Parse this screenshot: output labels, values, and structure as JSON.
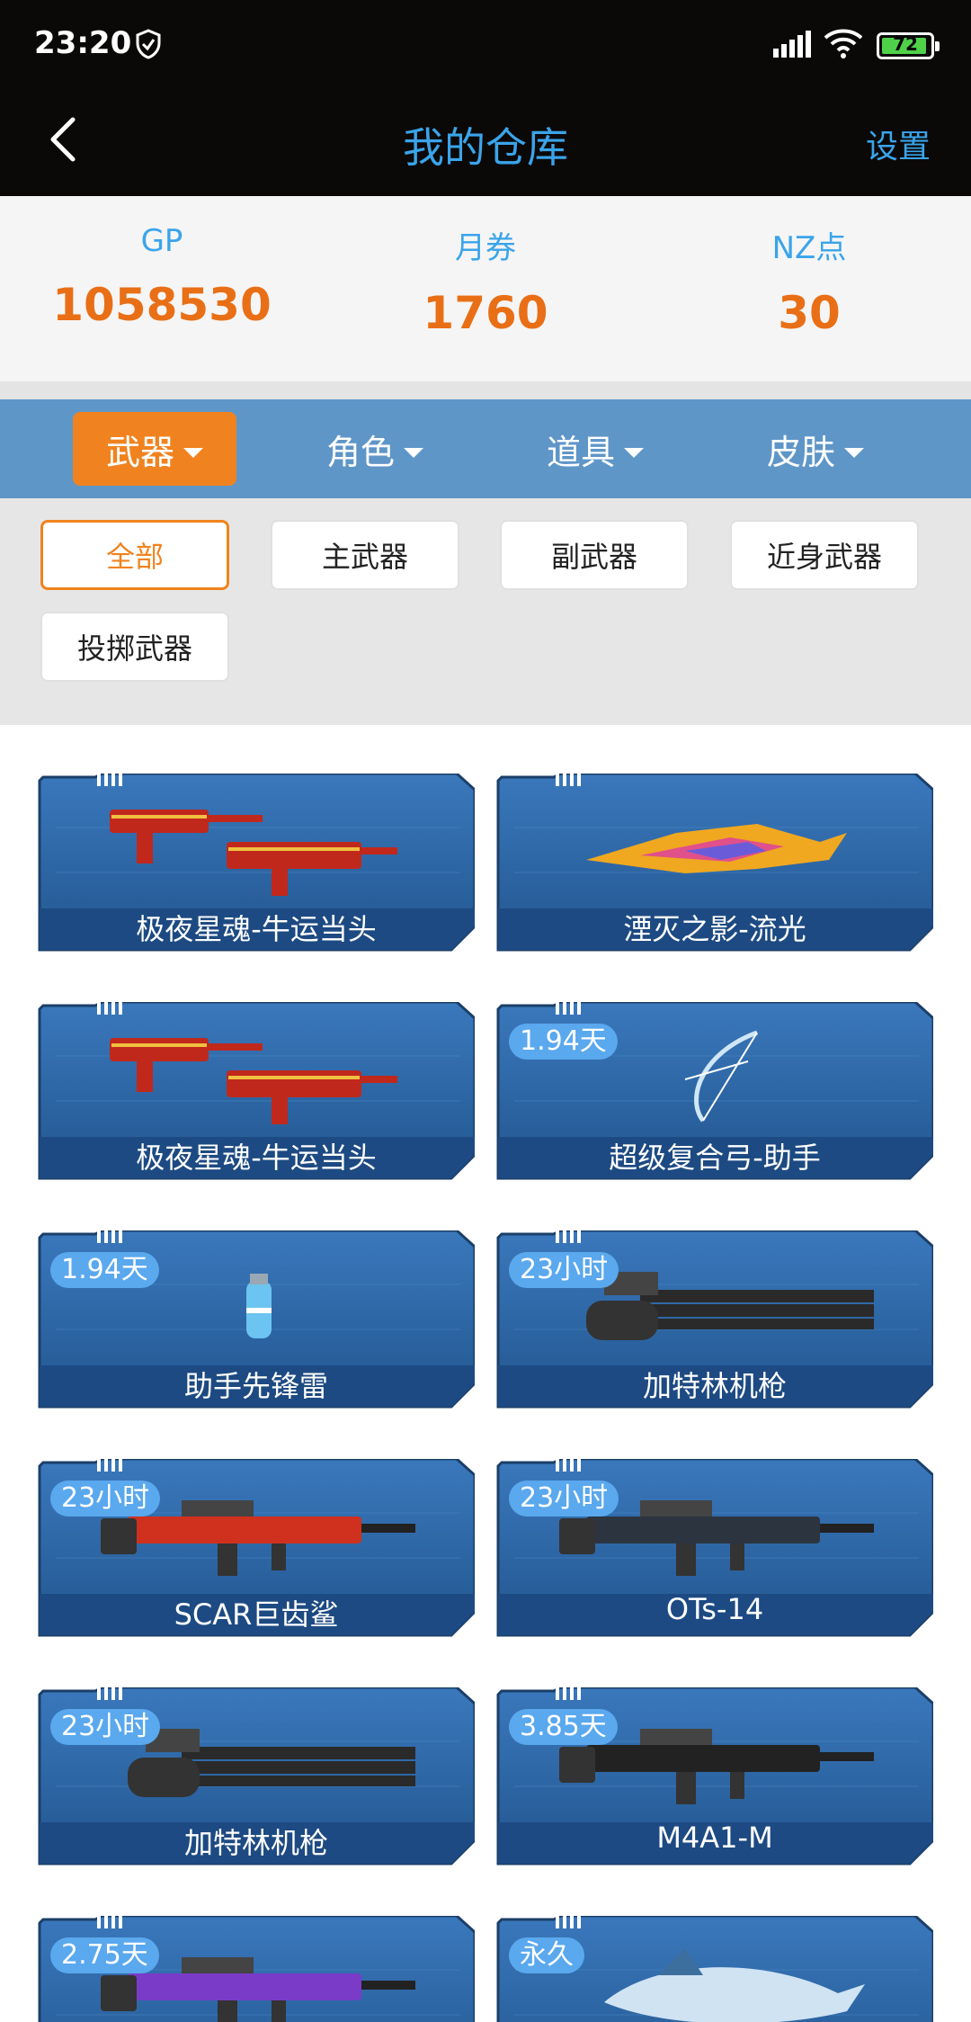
{
  "status": {
    "time": "23:20",
    "battery": "72"
  },
  "nav": {
    "title": "我的仓库",
    "settings": "设置"
  },
  "currency": [
    {
      "label": "GP",
      "value": "1058530"
    },
    {
      "label": "月券",
      "value": "1760"
    },
    {
      "label": "NZ点",
      "value": "30"
    }
  ],
  "categories": [
    "武器",
    "角色",
    "道具",
    "皮肤"
  ],
  "subcategories": [
    "全部",
    "主武器",
    "副武器",
    "近身武器",
    "投掷武器"
  ],
  "items": [
    {
      "name": "极夜星魂-牛运当头",
      "badge": "",
      "icon": "smg-icon",
      "accent": "#c0281c"
    },
    {
      "name": "湮灭之影-流光",
      "badge": "",
      "icon": "blade-icon",
      "accent": "#f0a820"
    },
    {
      "name": "极夜星魂-牛运当头",
      "badge": "",
      "icon": "smg-icon",
      "accent": "#c0281c"
    },
    {
      "name": "超级复合弓-助手",
      "badge": "1.94天",
      "icon": "bow-icon",
      "accent": "#cfe6f5"
    },
    {
      "name": "助手先锋雷",
      "badge": "1.94天",
      "icon": "grenade-icon",
      "accent": "#6cc4f0"
    },
    {
      "name": "加特林机枪",
      "badge": "23小时",
      "icon": "gatling-icon",
      "accent": "#2a2a2a"
    },
    {
      "name": "SCAR巨齿鲨",
      "badge": "23小时",
      "icon": "rifle-icon",
      "accent": "#d0301e"
    },
    {
      "name": "OTs-14",
      "badge": "23小时",
      "icon": "rifle-icon",
      "accent": "#2c3440"
    },
    {
      "name": "加特林机枪",
      "badge": "23小时",
      "icon": "gatling-icon",
      "accent": "#2a2a2a"
    },
    {
      "name": "M4A1-M",
      "badge": "3.85天",
      "icon": "rifle-icon",
      "accent": "#222222"
    },
    {
      "name": "",
      "badge": "2.75天",
      "icon": "rifle-icon",
      "accent": "#7a3cc8"
    },
    {
      "name": "",
      "badge": "永久",
      "icon": "shark-icon",
      "accent": "#cfe3f3"
    }
  ],
  "colors": {
    "accent": "#f0831f",
    "blue": "#3aa4ea",
    "tabbar": "#5f96c8",
    "card": "#2a64a4"
  }
}
